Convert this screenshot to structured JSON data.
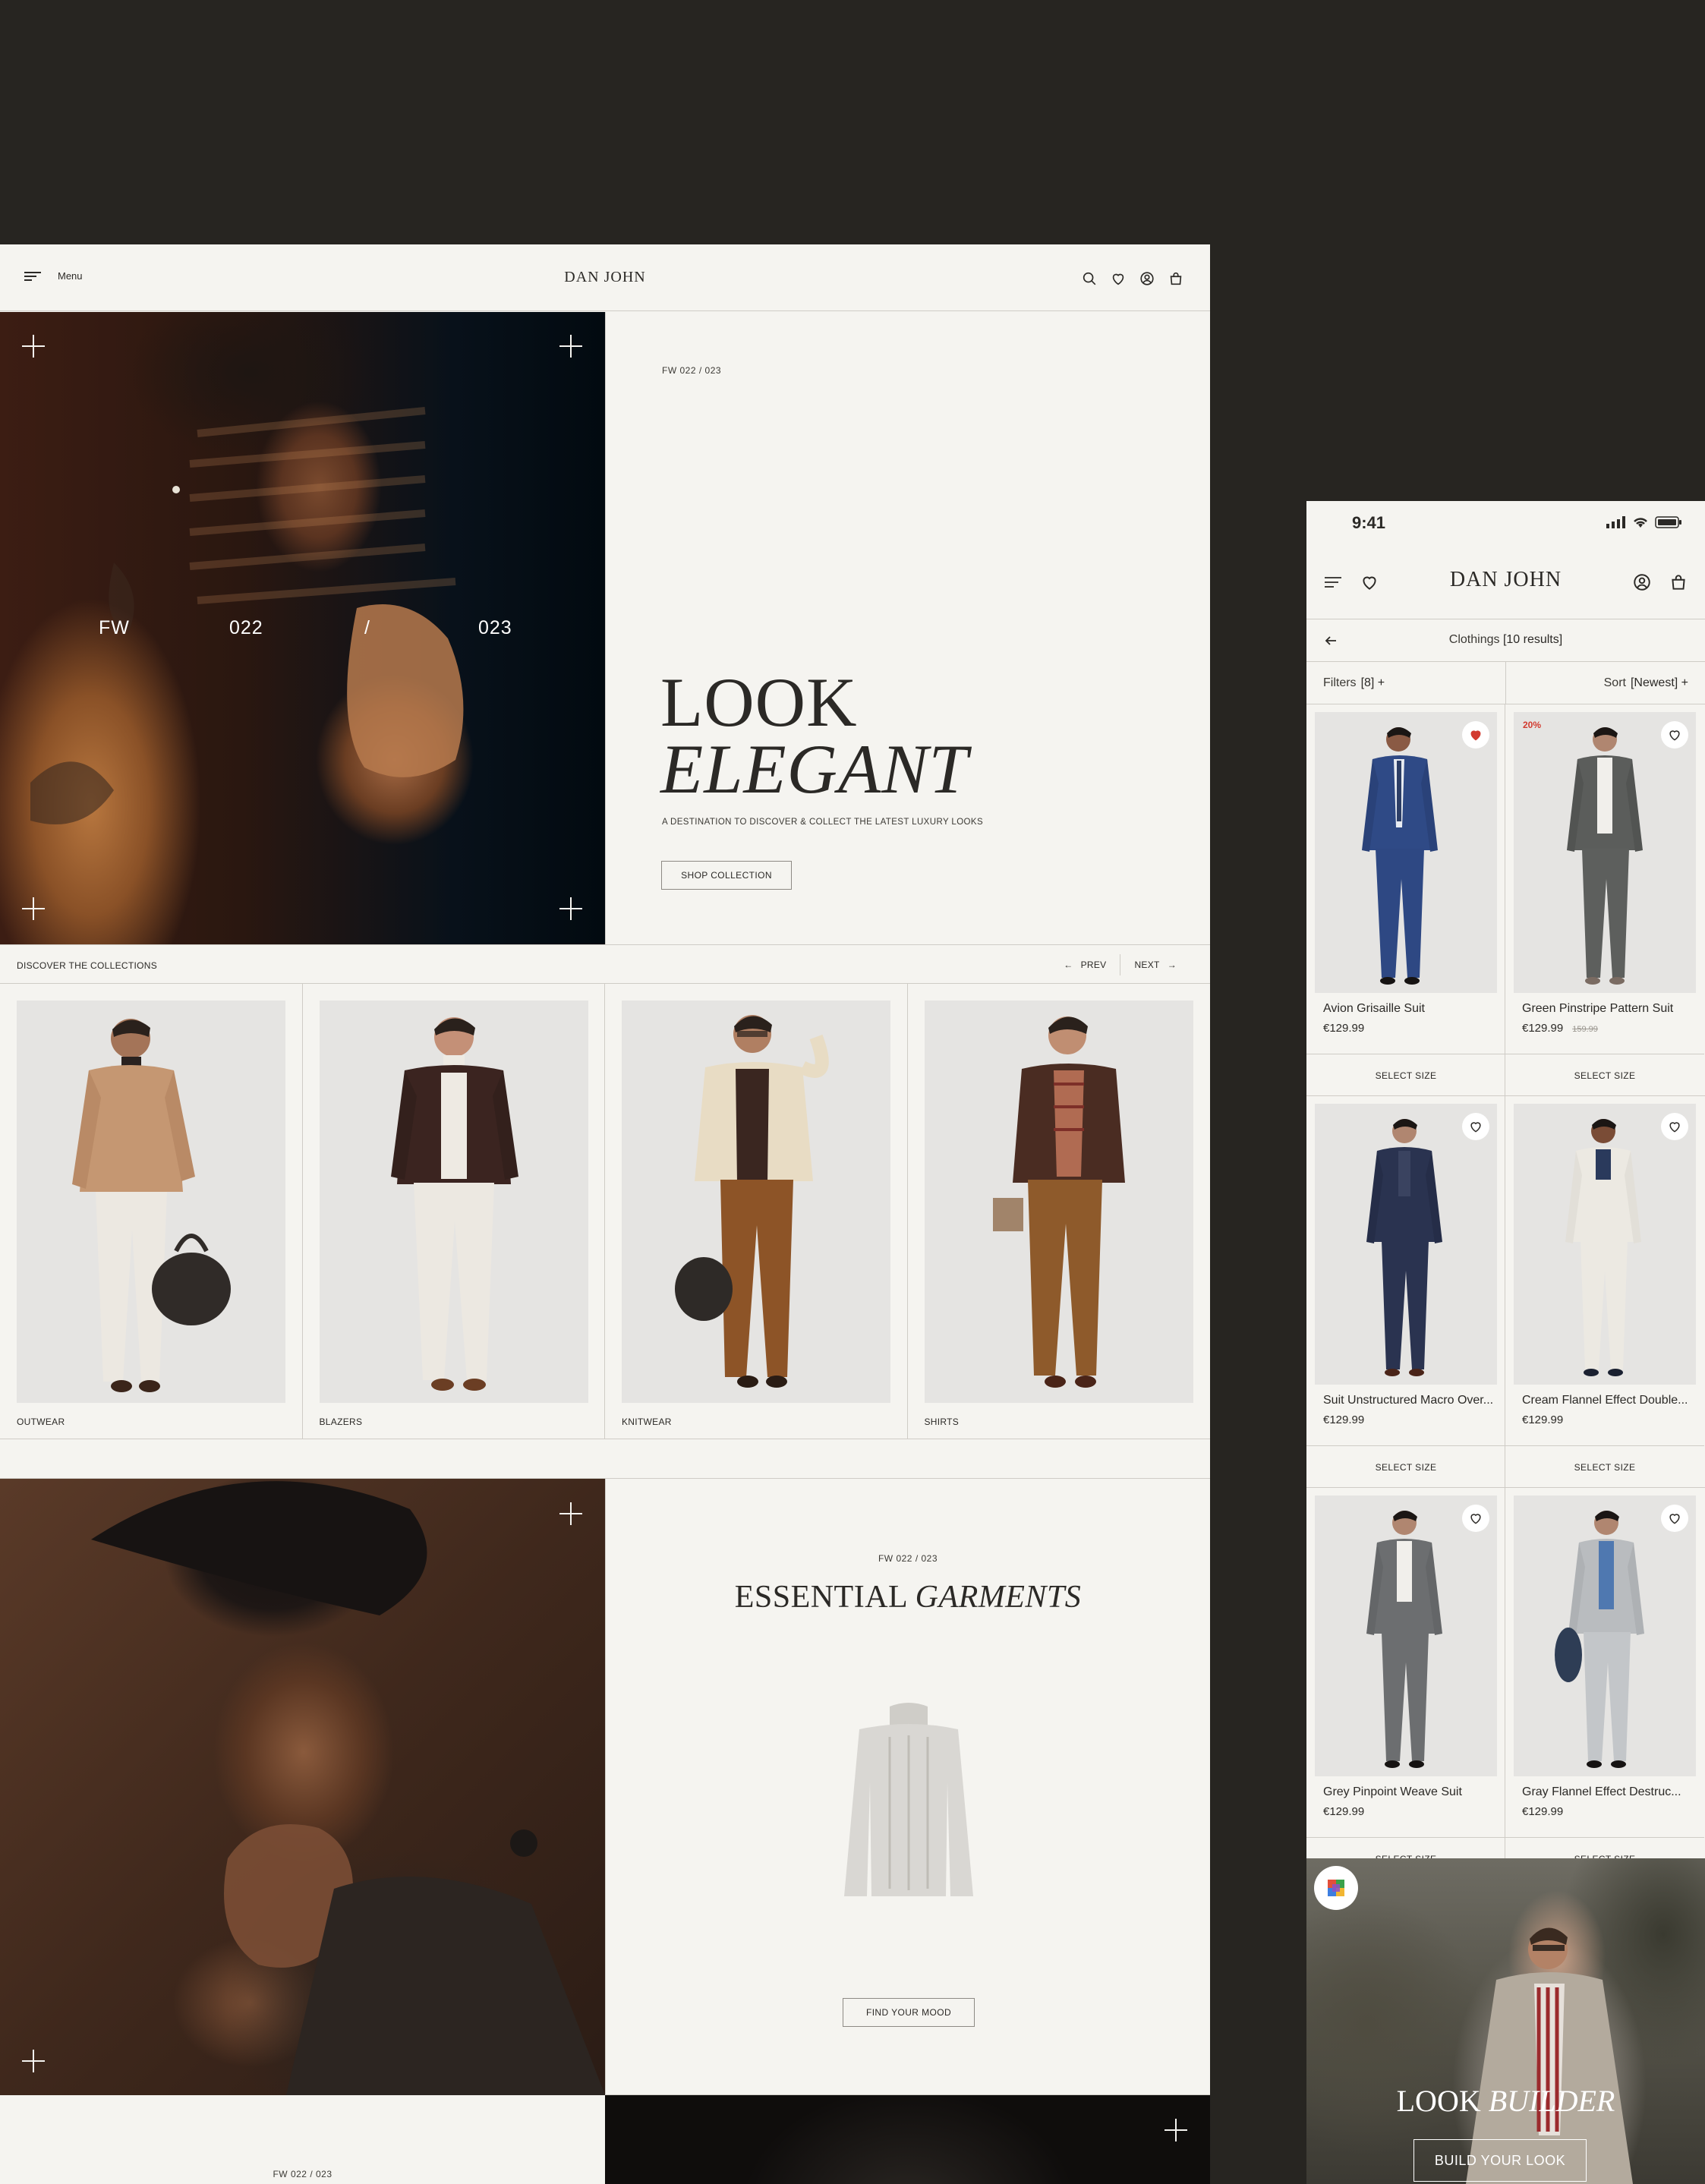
{
  "desktop": {
    "header": {
      "menu_label": "Menu",
      "brand": "DAN JOHN",
      "icons": [
        "search-icon",
        "heart-icon",
        "account-icon",
        "bag-icon"
      ]
    },
    "hero": {
      "overlay": {
        "fw": "FW",
        "year1": "022",
        "slash": "/",
        "year2": "023"
      },
      "season": "FW 022 / 023",
      "title_line1": "LOOK",
      "title_line2": "ELEGANT",
      "subtitle": "A DESTINATION TO DISCOVER & COLLECT THE LATEST LUXURY LOOKS",
      "cta": "SHOP COLLECTION"
    },
    "collections": {
      "label": "DISCOVER THE COLLECTIONS",
      "prev": "PREV",
      "next": "NEXT",
      "items": [
        {
          "name": "OUTWEAR"
        },
        {
          "name": "BLAZERS"
        },
        {
          "name": "KNITWEAR"
        },
        {
          "name": "SHIRTS"
        }
      ]
    },
    "essential": {
      "season": "FW 022 / 023",
      "title_plain": "ESSENTIAL",
      "title_italic": "GARMENTS",
      "cta": "FIND YOUR MOOD"
    },
    "section3": {
      "season": "FW 022 / 023"
    }
  },
  "mobile": {
    "status": {
      "time": "9:41"
    },
    "header": {
      "brand": "DAN JOHN"
    },
    "breadcrumb": {
      "title": "Clothings",
      "count": "[10 results]"
    },
    "filters": {
      "label": "Filters",
      "value": "[8] +"
    },
    "sort": {
      "label": "Sort",
      "value": "[Newest] +"
    },
    "select_size": "SELECT SIZE",
    "products": [
      {
        "name": "Avion Grisaille Suit",
        "price": "€129.99",
        "favorited": true
      },
      {
        "name": "Green Pinstripe Pattern Suit",
        "price": "€129.99",
        "old_price": "159.99",
        "badge": "20%",
        "favorited": false
      },
      {
        "name": "Suit Unstructured Macro Over...",
        "price": "€129.99",
        "favorited": false
      },
      {
        "name": "Cream Flannel Effect Double...",
        "price": "€129.99",
        "favorited": false
      },
      {
        "name": "Grey Pinpoint Weave Suit",
        "price": "€129.99",
        "favorited": false
      },
      {
        "name": "Gray Flannel Effect Destruc...",
        "price": "€129.99",
        "favorited": false
      }
    ],
    "look_builder": {
      "title_plain": "LOOK",
      "title_italic": "BUILDER",
      "cta": "BUILD YOUR LOOK"
    }
  },
  "colors": {
    "page_bg": "#272521",
    "surface": "#f5f4f0",
    "text": "#2b2926",
    "accent_red": "#d23a2f"
  }
}
